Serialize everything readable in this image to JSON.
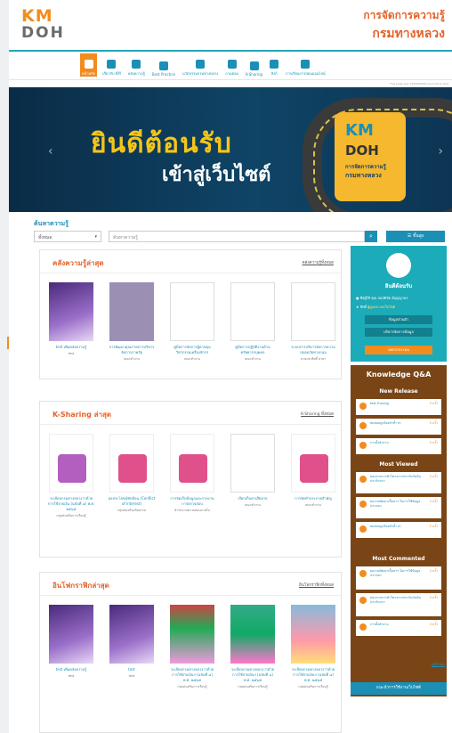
{
  "brand": {
    "logo_km": "KM",
    "logo_doh": "DOH",
    "title1": "การจัดการความรู้",
    "title2": "กรมทางหลวง"
  },
  "nav": [
    {
      "label": "หน้าหลัก",
      "icon": "home-icon",
      "active": true
    },
    {
      "label": "เกี่ยวกับ KM",
      "icon": "info-icon"
    },
    {
      "label": "คลังความรู้",
      "icon": "book-icon"
    },
    {
      "label": "Best Practice",
      "icon": "thumbs-up-icon"
    },
    {
      "label": "นวัตกรรมกรมทางหลวง",
      "icon": "lightbulb-icon"
    },
    {
      "label": "ถามตอบ",
      "icon": "chat-icon"
    },
    {
      "label": "K-Sharing",
      "icon": "share-icon"
    },
    {
      "label": "ลิงก์",
      "icon": "link-icon"
    },
    {
      "label": "การเรียนการสอนออนไลน์",
      "icon": "laptop-icon"
    }
  ],
  "tiny": "This page was 1300000000 seconds to load",
  "banner": {
    "welcome": "ยินดีต้อนรับ",
    "sub": "เข้าสู่เว็บไซต์",
    "sign_km": "KM",
    "sign_doh": "DOH",
    "sign_t1": "การจัดการความรู้",
    "sign_t2": "กรมทางหลวง"
  },
  "search": {
    "title": "ค้นหาความรู้",
    "select": "ทั้งหมด",
    "placeholder": "ค้นหาความรู้",
    "advanced": "ขั้นสูง"
  },
  "knowledge": {
    "title": "คลังความรู้ล่าสุด",
    "more": "คลังความรู้ทั้งหมด",
    "items": [
      {
        "cap": "test เพิ่มคลังความรู้",
        "sub": "test",
        "thumb": "t-purple"
      },
      {
        "cap": "การพัฒนาคุณภาพการบริหารจัดการภาครัฐ",
        "sub": "คณะทำงาน",
        "thumb": "t-grey"
      },
      {
        "cap": "คู่มือการจัดการผู้ควบคุมวิศวกรรมเครื่องจักรฯ",
        "sub": "คณะทำงาน",
        "thumb": "t-doc"
      },
      {
        "cap": "คู่มือการปฏิบัติงานด้านทรัพยากรบุคคล",
        "sub": "คณะทำงาน",
        "thumb": "t-doc"
      },
      {
        "cap": "ระบบการบริหารจัดการความปลอดภัยทางถนน",
        "sub": "นายประสิทธิ์ สายฯ",
        "thumb": "t-doc"
      }
    ]
  },
  "sharing": {
    "title": "K-Sharing ล่าสุด",
    "more": "K-Sharing ทั้งหมด",
    "items": [
      {
        "cap": "ระเบียบกรมทางหลวงว่าด้วยการใช้จ่ายเงิน (ฉบับที่ ๔) พ.ศ. ๒๕๖๕",
        "sub": "กลุ่มส่งเสริมการเรียนรู้",
        "thumb": "pur"
      },
      {
        "cap": "ผลประโยชน์ทับซ้อน (Conflict of Interest)",
        "sub": "กลุ่มส่งเสริมจริยธรรม",
        "thumb": ""
      },
      {
        "cap": "การจัดเก็บข้อมูลและรายงานการตรวจสอบ",
        "sub": "สำนักงานตรวจสอบภายใน",
        "thumb": ""
      },
      {
        "cap": "เรียกเก็บค่าเสียหาย",
        "sub": "คณะทำงาน",
        "thumb": "doc"
      },
      {
        "cap": "การจัดทำประกาศสำคัญ",
        "sub": "คณะทำงาน",
        "thumb": ""
      }
    ]
  },
  "infographic": {
    "title": "อินโฟกราฟิกล่าสุด",
    "more": "อินโฟกราฟิกทั้งหมด",
    "items": [
      {
        "cap": "test เพิ่มคลังความรู้",
        "sub": "test",
        "thumb": "t-purple"
      },
      {
        "cap": "test",
        "sub": "test",
        "thumb": "t-purple"
      },
      {
        "cap": "ระเบียบกรมทางหลวงว่าด้วยการใช้จ่ายเงินฯ (ฉบับที่ ๔) พ.ศ. ๒๕๖๕",
        "sub": "กลุ่มส่งเสริมการเรียนรู้",
        "thumb": "t-poster"
      },
      {
        "cap": "ระเบียบกรมทางหลวงว่าด้วยการใช้จ่ายเงินฯ (ฉบับที่ ๔) พ.ศ. ๒๕๖๕",
        "sub": "กลุ่มส่งเสริมการเรียนรู้",
        "thumb": "t-poster2"
      },
      {
        "cap": "ระเบียบกรมทางหลวงว่าด้วยการใช้จ่ายเงินฯ (ฉบับที่ ๔) พ.ศ. ๒๕๖๕",
        "sub": "กลุ่มส่งเสริมการเรียนรู้",
        "thumb": "t-poster3"
      }
    ]
  },
  "welcome": {
    "title": "ยินดีต้อนรับ",
    "name_label": "ชื่อผู้ใช้",
    "name": "คุณ สมบัติชัย มีบุญญาพร",
    "role_label": "สิทธิ์",
    "role": "ผู้ดูแลระบบเว็บไซต์",
    "btn1": "ข้อมูลส่วนตัว",
    "btn2": "บริหารจัดการข้อมูล",
    "btn3": "ออกจากระบบ"
  },
  "qa": {
    "title": "Knowledge Q&A",
    "new": "New Release",
    "viewed": "Most Viewed",
    "commented": "Most Commented",
    "more": "ดูทั้งหมด",
    "rows": [
      {
        "q": "test ถ้าตอบคู่",
        "c": "0 ครั้ง"
      },
      {
        "q": "ทดสอบถูกต้องทำซ้ำ m",
        "c": "0 ครั้ง"
      },
      {
        "q": "การตั้งคำถาม",
        "c": "0 ครั้ง"
      },
      {
        "q": "สอบถามการทำโครงการประกันภัยเงินประกันรถฯ",
        "c": "0 ครั้ง"
      },
      {
        "q": "ผลงานพัฒนาเนื้อหาฯ ในการใช้ข้อมูลประกอบ",
        "c": "0 ครั้ง"
      },
      {
        "q": "ทดสอบถูกต้องทำซ้ำ m",
        "c": "0 ครั้ง"
      },
      {
        "q": "ผลงานพัฒนาเนื้อหาฯ ในการใช้ข้อมูลประกอบ",
        "c": "0 ครั้ง"
      },
      {
        "q": "สอบถามการทำโครงการประกันภัยเงินประกันรถฯ",
        "c": "0 ครั้ง"
      },
      {
        "q": "การตั้งคำถาม",
        "c": "0 ครั้ง"
      }
    ]
  },
  "guide": "แนะนำการใช้งานเว็บไซต์"
}
